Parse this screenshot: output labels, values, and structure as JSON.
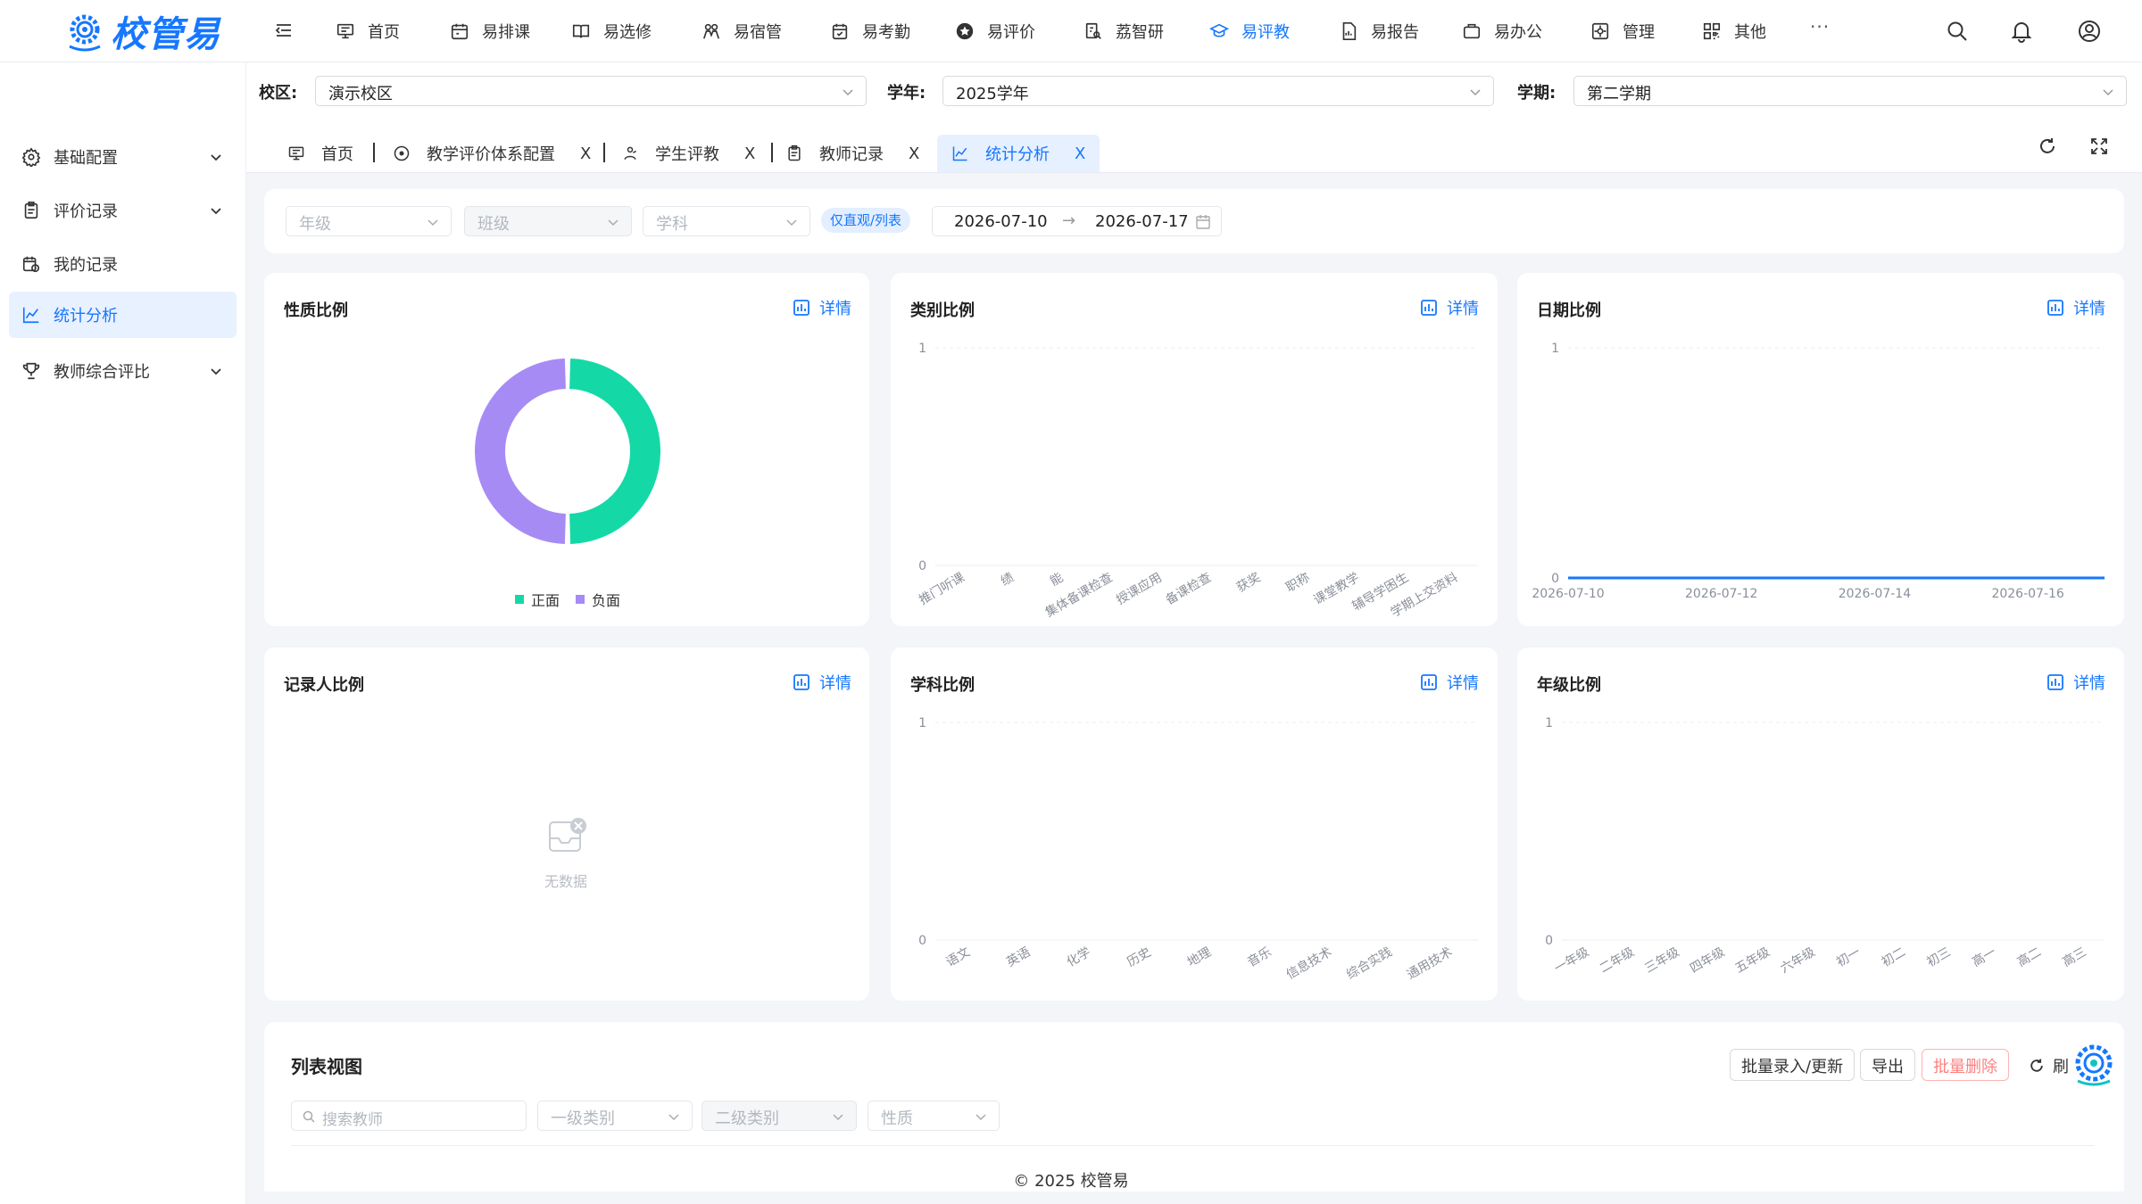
{
  "app": {
    "logo_text": "校管易"
  },
  "nav": {
    "items": [
      {
        "label": "首页",
        "icon": "monitor-icon"
      },
      {
        "label": "易排课",
        "icon": "calendar-icon"
      },
      {
        "label": "易选修",
        "icon": "book-icon"
      },
      {
        "label": "易宿管",
        "icon": "dorm-icon"
      },
      {
        "label": "易考勤",
        "icon": "check-calendar-icon"
      },
      {
        "label": "易评价",
        "icon": "star-icon"
      },
      {
        "label": "荔智研",
        "icon": "research-icon"
      },
      {
        "label": "易评教",
        "icon": "graduation-cap-icon",
        "active": true
      },
      {
        "label": "易报告",
        "icon": "report-icon"
      },
      {
        "label": "易办公",
        "icon": "briefcase-icon"
      },
      {
        "label": "管理",
        "icon": "settings-box-icon"
      },
      {
        "label": "其他",
        "icon": "grid-icon"
      }
    ],
    "more": "···"
  },
  "sidebar": {
    "items": [
      {
        "label": "基础配置",
        "icon": "gear-icon",
        "expandable": true
      },
      {
        "label": "评价记录",
        "icon": "clipboard-icon",
        "expandable": true
      },
      {
        "label": "我的记录",
        "icon": "calendar-record-icon",
        "expandable": false
      },
      {
        "label": "统计分析",
        "icon": "line-chart-icon",
        "expandable": false,
        "active": true
      },
      {
        "label": "教师综合评比",
        "icon": "trophy-icon",
        "expandable": true
      }
    ]
  },
  "filters": {
    "campus_label": "校区:",
    "campus_value": "演示校区",
    "year_label": "学年:",
    "year_value": "2025学年",
    "term_label": "学期:",
    "term_value": "第二学期"
  },
  "tabs": [
    {
      "label": "首页",
      "icon": "monitor-icon",
      "closable": false
    },
    {
      "label": "教学评价体系配置",
      "icon": "target-icon",
      "closable": true
    },
    {
      "label": "学生评教",
      "icon": "student-icon",
      "closable": true
    },
    {
      "label": "教师记录",
      "icon": "clipboard-icon",
      "closable": true
    },
    {
      "label": "统计分析",
      "icon": "line-chart-icon",
      "closable": true,
      "active": true
    }
  ],
  "tab_close_glyph": "X",
  "query": {
    "grade_placeholder": "年级",
    "class_placeholder": "班级",
    "subject_placeholder": "学科",
    "mode_badge": "仅直观/列表",
    "date_start": "2026-07-10",
    "date_arrow": "→",
    "date_end": "2026-07-17"
  },
  "detail_label": "详情",
  "colors": {
    "accent": "#1677ff",
    "positive": "#14d9a6",
    "negative": "#a78bf5",
    "danger": "#ff8080"
  },
  "charts": {
    "nature": {
      "title": "性质比例"
    },
    "category": {
      "title": "类别比例"
    },
    "date": {
      "title": "日期比例"
    },
    "recorder": {
      "title": "记录人比例",
      "empty_text": "无数据"
    },
    "subject": {
      "title": "学科比例"
    },
    "grade": {
      "title": "年级比例"
    }
  },
  "chart_data": [
    {
      "type": "pie",
      "title": "性质比例",
      "labels": [
        "正面",
        "负面"
      ],
      "values": [
        1,
        1
      ],
      "donut": true,
      "legend": "bottom"
    },
    {
      "type": "bar",
      "title": "类别比例",
      "categories": [
        "推门听课",
        "绩",
        "能",
        "集体备课检查",
        "授课应用",
        "备课检查",
        "获奖",
        "职称",
        "课堂教学",
        "辅导学困生",
        "学期上交资料"
      ],
      "values": [
        0,
        0,
        0,
        0,
        0,
        0,
        0,
        0,
        0,
        0,
        0
      ],
      "ylim": [
        0,
        1
      ],
      "yticks": [
        0,
        1
      ]
    },
    {
      "type": "line",
      "title": "日期比例",
      "x": [
        "2026-07-10",
        "2026-07-11",
        "2026-07-12",
        "2026-07-13",
        "2026-07-14",
        "2026-07-15",
        "2026-07-16",
        "2026-07-17"
      ],
      "xticks": [
        "2026-07-10",
        "2026-07-12",
        "2026-07-14",
        "2026-07-16"
      ],
      "values": [
        0,
        0,
        0,
        0,
        0,
        0,
        0,
        0
      ],
      "ylim": [
        0,
        1
      ],
      "yticks": [
        0,
        1
      ]
    },
    {
      "type": "bar",
      "title": "学科比例",
      "categories": [
        "语文",
        "英语",
        "化学",
        "历史",
        "地理",
        "音乐",
        "信息技术",
        "综合实践",
        "通用技术"
      ],
      "values": [
        0,
        0,
        0,
        0,
        0,
        0,
        0,
        0,
        0
      ],
      "ylim": [
        0,
        1
      ],
      "yticks": [
        0,
        1
      ]
    },
    {
      "type": "bar",
      "title": "年级比例",
      "categories": [
        "一年级",
        "二年级",
        "三年级",
        "四年级",
        "五年级",
        "六年级",
        "初一",
        "初二",
        "初三",
        "高一",
        "高二",
        "高三"
      ],
      "values": [
        0,
        0,
        0,
        0,
        0,
        0,
        0,
        0,
        0,
        0,
        0,
        0
      ],
      "ylim": [
        0,
        1
      ],
      "yticks": [
        0,
        1
      ]
    }
  ],
  "list": {
    "title": "列表视图",
    "batch_label": "批量录入/更新",
    "export_label": "导出",
    "delete_label": "批量删除",
    "refresh_label": "刷",
    "search_placeholder": "搜索教师",
    "cat1_placeholder": "一级类别",
    "cat2_placeholder": "二级类别",
    "nature_placeholder": "性质"
  },
  "footer": "© 2025 校管易"
}
